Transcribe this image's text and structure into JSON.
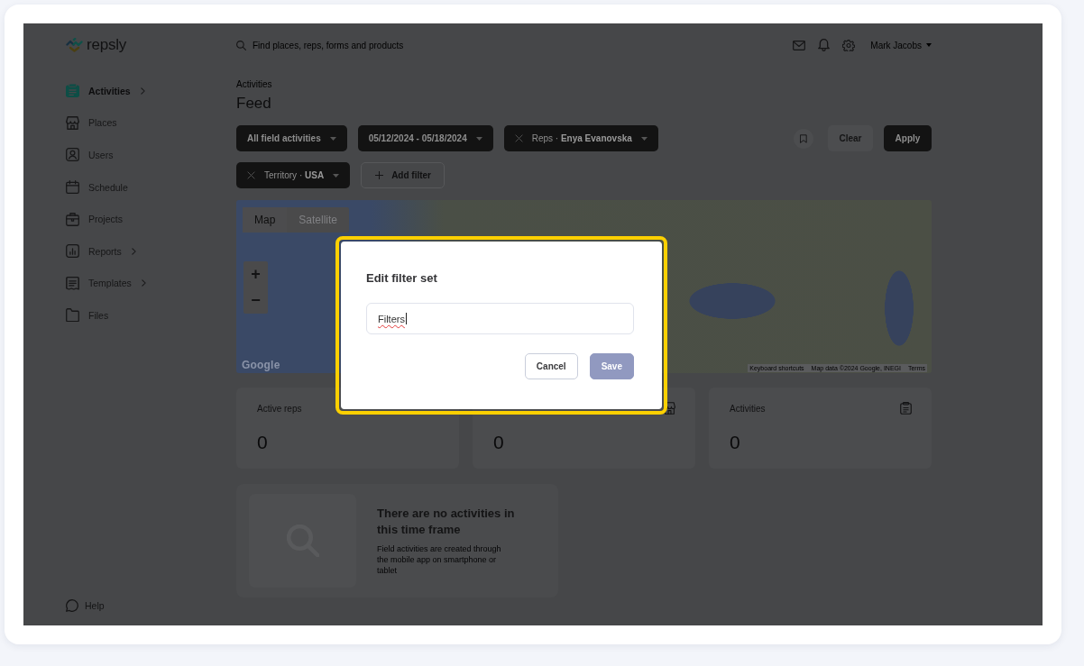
{
  "header": {
    "logo": "repsly",
    "search": {
      "placeholder": "Find places, reps, forms and products"
    },
    "user": "Mark Jacobs"
  },
  "sidebar": {
    "items": [
      {
        "label": "Activities",
        "selected": true,
        "submenu": true
      },
      {
        "label": "Places",
        "selected": false,
        "submenu": false
      },
      {
        "label": "Users",
        "selected": false,
        "submenu": false
      },
      {
        "label": "Schedule",
        "selected": false,
        "submenu": false
      },
      {
        "label": "Projects",
        "selected": false,
        "submenu": false
      },
      {
        "label": "Reports",
        "selected": false,
        "submenu": true
      },
      {
        "label": "Templates",
        "selected": false,
        "submenu": true
      },
      {
        "label": "Files",
        "selected": false,
        "submenu": false
      }
    ],
    "help": "Help"
  },
  "page": {
    "breadcrumb": "Activities",
    "title": "Feed"
  },
  "filters": {
    "chips": [
      {
        "kind": "select",
        "label": "All field activities"
      },
      {
        "kind": "select",
        "label": "05/12/2024 - 05/18/2024"
      },
      {
        "kind": "removable",
        "label": "Reps · **Enya Evanovska**"
      },
      {
        "kind": "removable",
        "label": "Territory · **USA**"
      }
    ],
    "add_filter": "Add filter",
    "clear": "Clear",
    "apply": "Apply"
  },
  "map": {
    "tabs": [
      {
        "label": "Map",
        "selected": true
      },
      {
        "label": "Satellite",
        "selected": false
      }
    ],
    "zoom": [
      "+",
      "−"
    ],
    "logo": "Google",
    "attribution": [
      "Keyboard shortcuts",
      "Map data ©2024 Google, INEGI",
      "Terms"
    ]
  },
  "stats": [
    {
      "label": "Active reps",
      "value": "0"
    },
    {
      "value": "0"
    },
    {
      "label": "Activities",
      "value": "0"
    }
  ],
  "empty_state": {
    "title": "There are no activities in this time frame",
    "text": "Field activities are created through the mobile app on smartphone or tablet"
  },
  "dialog": {
    "highlighted": true,
    "title": "Edit filter set",
    "input": {
      "value": "Filters",
      "misspelled": true
    },
    "buttons": [
      {
        "label": "Cancel",
        "kind": "secondary",
        "disabled": false
      },
      {
        "label": "Save",
        "kind": "primary",
        "disabled": true
      }
    ]
  }
}
